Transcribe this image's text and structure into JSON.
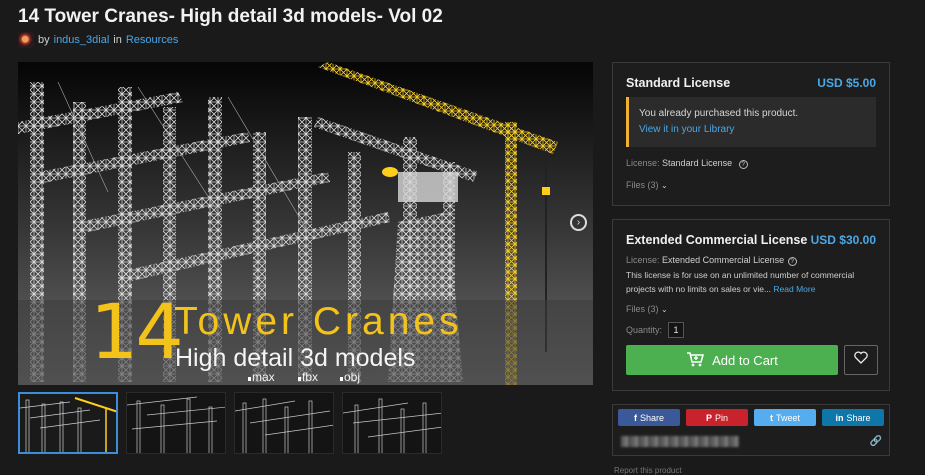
{
  "product": {
    "title": "14 Tower Cranes- High detail 3d models- Vol 02",
    "by_label": "by",
    "author": "indus_3dial",
    "in_label": "in",
    "category": "Resources"
  },
  "hero": {
    "big_number": "14",
    "headline": "Tower Cranes",
    "subheadline": "High detail 3d models",
    "formats": [
      "max",
      "fbx",
      "obj"
    ],
    "accent_color": "#f3c31c",
    "next_icon": "chevron-right-circle-icon"
  },
  "thumbnails": [
    {
      "label": "thumbnail 1",
      "active": true
    },
    {
      "label": "thumbnail 2",
      "active": false
    },
    {
      "label": "thumbnail 3",
      "active": false
    },
    {
      "label": "thumbnail 4",
      "active": false
    }
  ],
  "standard_license": {
    "title": "Standard License",
    "price": "USD $5.00",
    "notice_text": "You already purchased this product.",
    "notice_link": "View it in your Library",
    "license_label": "License:",
    "license_value": "Standard License",
    "files_label": "Files (3)"
  },
  "extended_license": {
    "title": "Extended Commercial License",
    "price": "USD $30.00",
    "license_label": "License:",
    "license_value": "Extended Commercial License",
    "description": "This license is for use on an unlimited number of commercial projects with no limits on sales or vie...",
    "read_more": "Read More",
    "files_label": "Files (3)",
    "quantity_label": "Quantity:",
    "quantity_value": "1",
    "add_to_cart": "Add to Cart",
    "cart_color": "#4caf50"
  },
  "share": {
    "buttons": [
      {
        "icon": "f",
        "label": "Share",
        "color": "#3b5998"
      },
      {
        "icon": "P",
        "label": "Pin",
        "color": "#c8232c"
      },
      {
        "icon": "t",
        "label": "Tweet",
        "color": "#55acee"
      },
      {
        "icon": "in",
        "label": "Share",
        "color": "#0e76a8"
      }
    ]
  },
  "footer": {
    "report_label": "Report this product"
  },
  "colors": {
    "background": "#1a1a1a",
    "link": "#4aa8e6",
    "notice_border": "#f0b030"
  }
}
